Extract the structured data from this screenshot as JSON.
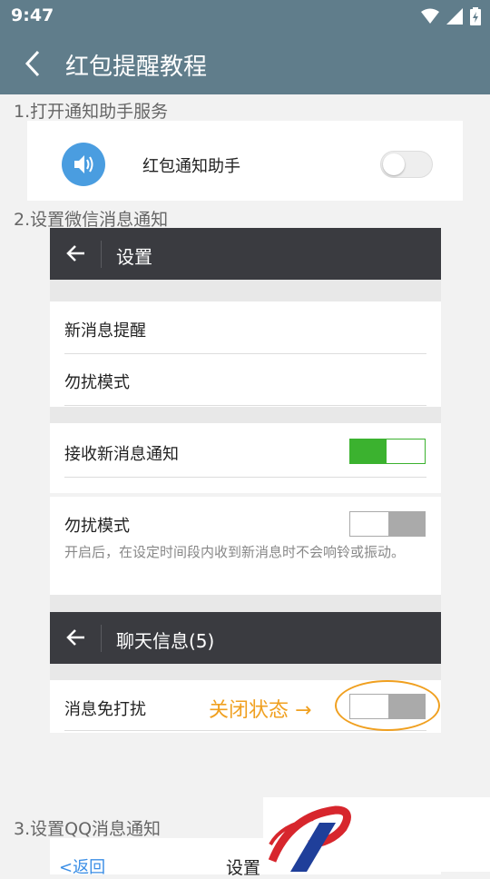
{
  "status_bar": {
    "time": "9:47"
  },
  "app_bar": {
    "title": "红包提醒教程",
    "back_icon": "back-chevron-icon"
  },
  "step1": {
    "title": "1.打开通知助手服务",
    "service_label": "红包通知助手",
    "icon": "speaker-icon",
    "toggle_on": false
  },
  "step2": {
    "title": "2.设置微信消息通知",
    "settings_header": "设置",
    "rows": {
      "new_message_alert": "新消息提醒",
      "dnd_mode": "勿扰模式",
      "receive_new_notifications": "接收新消息通知",
      "dnd_mode2": "勿扰模式",
      "dnd_desc": "开启后，在设定时间段内收到新消息时不会响铃或振动。"
    },
    "receive_toggle_on": true,
    "dnd_toggle_on": false,
    "chat_header": "聊天信息(5)",
    "mute_label": "消息免打扰",
    "mute_toggle_on": false,
    "annotation": "关闭状态 →"
  },
  "step3": {
    "title": "3.设置QQ消息通知",
    "back_label": "<返回",
    "header": "设置"
  },
  "colors": {
    "app_bar": "#607d8b",
    "wechat_bar": "#3a3b40",
    "toggle_green": "#3bb22f",
    "annotation": "#f0a020"
  }
}
